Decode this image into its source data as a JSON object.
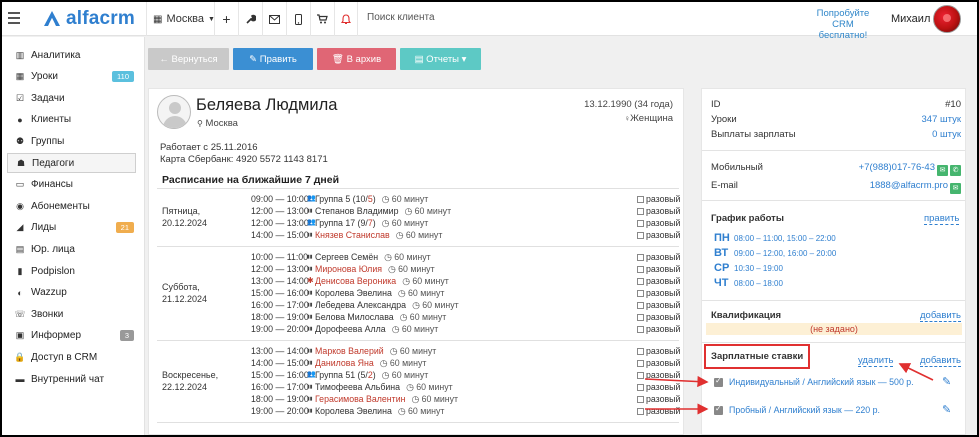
{
  "colors": {
    "accent": "#2f7fcf",
    "back": "#c9c9c9",
    "edit": "#3b8fd3",
    "archive": "#e06675",
    "reports": "#5dc9c5",
    "red_link": "#c0392b",
    "highlight": "#e03030",
    "badge_blue": "#5bc0de",
    "badge_orange": "#f0ad4e",
    "badge_gray": "#999999"
  },
  "topbar": {
    "logo_text": "alfacrm",
    "branch": "Москва",
    "search_placeholder": "Поиск клиента",
    "promo_line1": "Попробуйте",
    "promo_line2": "CRM бесплатно!",
    "user_name": "Михаил",
    "icons": [
      "menu-icon",
      "plus-icon",
      "wrench-icon",
      "mail-icon",
      "phone-icon",
      "cart-icon",
      "bell-icon"
    ]
  },
  "sidebar": {
    "items": [
      {
        "label": "Аналитика",
        "icon": "analytics-icon"
      },
      {
        "label": "Уроки",
        "icon": "calendar-icon",
        "badge": "110"
      },
      {
        "label": "Задачи",
        "icon": "tasks-icon"
      },
      {
        "label": "Клиенты",
        "icon": "user-icon"
      },
      {
        "label": "Группы",
        "icon": "users-icon"
      },
      {
        "label": "Педагоги",
        "icon": "teacher-icon"
      },
      {
        "label": "Финансы",
        "icon": "money-icon"
      },
      {
        "label": "Абонементы",
        "icon": "ticket-icon"
      },
      {
        "label": "Лиды",
        "icon": "leads-icon",
        "badge": "21"
      },
      {
        "label": "Юр. лица",
        "icon": "building-icon"
      },
      {
        "label": "Podpislon",
        "icon": "document-icon"
      },
      {
        "label": "Wazzup",
        "icon": "chat-icon"
      },
      {
        "label": "Звонки",
        "icon": "phone-icon"
      },
      {
        "label": "Информер",
        "icon": "informer-icon",
        "badge": "3"
      },
      {
        "label": "Доступ в CRM",
        "icon": "lock-icon"
      },
      {
        "label": "Внутренний чат",
        "icon": "chat-window-icon"
      }
    ]
  },
  "actions": {
    "back": "← Вернуться",
    "edit": "✎ Править",
    "archive": "🗑 В архив",
    "reports": "▤ Отчеты ▾"
  },
  "profile": {
    "name": "Беляева Людмила",
    "city": "Москва",
    "dob": "13.12.1990 (34 года)",
    "gender": "Женщина",
    "works_since": "Работает с 25.11.2016",
    "bank_card": "Карта Сбербанк: 4920 5572 1143 8171"
  },
  "schedule": {
    "title": "Расписание на ближайшие 7 дней",
    "days": [
      {
        "day": "Пятница,",
        "date": "20.12.2024",
        "rows": [
          {
            "time": "09:00 — 10:00",
            "kind": "group",
            "name": "Группа 5 (10/",
            "name_red": "5",
            "name_tail": ")",
            "dur": "60 минут",
            "rep": "разовый"
          },
          {
            "time": "12:00 — 13:00",
            "kind": "single",
            "name": "Степанов Владимир",
            "dur": "60 минут",
            "rep": "разовый"
          },
          {
            "time": "12:00 — 13:00",
            "kind": "group",
            "name": "Группа 17 (9/",
            "name_red": "7",
            "name_tail": ")",
            "dur": "60 минут",
            "rep": "разовый"
          },
          {
            "time": "14:00 — 15:00",
            "kind": "single",
            "name": "Князев Станислав",
            "red": true,
            "dur": "60 минут",
            "rep": "разовый"
          }
        ]
      },
      {
        "day": "Суббота,",
        "date": "21.12.2024",
        "rows": [
          {
            "time": "10:00 — 11:00",
            "kind": "single",
            "name": "Сергеев Семён",
            "dur": "60 минут",
            "rep": "разовый"
          },
          {
            "time": "12:00 — 13:00",
            "kind": "single",
            "name": "Миронова Юлия",
            "red": true,
            "dur": "60 минут",
            "rep": "разовый"
          },
          {
            "time": "13:00 — 14:00",
            "kind": "trial",
            "name": "Денисова Вероника",
            "red": true,
            "dur": "60 минут",
            "rep": "разовый"
          },
          {
            "time": "15:00 — 16:00",
            "kind": "single",
            "name": "Королева Эвелина",
            "dur": "60 минут",
            "rep": "разовый"
          },
          {
            "time": "16:00 — 17:00",
            "kind": "single",
            "name": "Лебедева Александра",
            "dur": "60 минут",
            "rep": "разовый"
          },
          {
            "time": "18:00 — 19:00",
            "kind": "single",
            "name": "Белова Милослава",
            "dur": "60 минут",
            "rep": "разовый"
          },
          {
            "time": "19:00 — 20:00",
            "kind": "single",
            "name": "Дорофеева Алла",
            "dur": "60 минут",
            "rep": "разовый"
          }
        ]
      },
      {
        "day": "Воскресенье,",
        "date": "22.12.2024",
        "rows": [
          {
            "time": "13:00 — 14:00",
            "kind": "single",
            "name": "Марков Валерий",
            "red": true,
            "dur": "60 минут",
            "rep": "разовый"
          },
          {
            "time": "14:00 — 15:00",
            "kind": "single",
            "name": "Данилова Яна",
            "red": true,
            "dur": "60 минут",
            "rep": "разовый"
          },
          {
            "time": "15:00 — 16:00",
            "kind": "group",
            "name": "Группа 51 (5/",
            "name_red": "2",
            "name_tail": ")",
            "dur": "60 минут",
            "rep": "разовый"
          },
          {
            "time": "16:00 — 17:00",
            "kind": "single",
            "name": "Тимофеева Альбина",
            "dur": "60 минут",
            "rep": "разовый"
          },
          {
            "time": "18:00 — 19:00",
            "kind": "single",
            "name": "Герасимова Валентин",
            "red": true,
            "dur": "60 минут",
            "rep": "разовый"
          },
          {
            "time": "19:00 — 20:00",
            "kind": "single",
            "name": "Королева Эвелина",
            "dur": "60 минут",
            "rep": "разовый"
          }
        ]
      }
    ]
  },
  "details": {
    "id_label": "ID",
    "id_value": "#10",
    "lessons_label": "Уроки",
    "lessons_value": "347 штук",
    "payouts_label": "Выплаты зарплаты",
    "payouts_value": "0 штук",
    "mobile_label": "Мобильный",
    "mobile_value": "+7(988)017-76-43",
    "email_label": "E-mail",
    "email_value": "1888@alfacrm.pro",
    "schedule_title": "График работы",
    "schedule_edit": "править",
    "work_days": [
      {
        "d": "ПН",
        "h": "08:00 – 11:00, 15:00 – 22:00"
      },
      {
        "d": "ВТ",
        "h": "09:00 – 12:00, 16:00 – 20:00"
      },
      {
        "d": "СР",
        "h": "10:30 – 19:00"
      },
      {
        "d": "ЧТ",
        "h": "08:00 – 18:00"
      }
    ],
    "qual_title": "Квалификация",
    "qual_add": "добавить",
    "qual_value": "(не задано)",
    "rates_title": "Зарплатные ставки",
    "rates_delete": "удалить",
    "rates_add": "добавить",
    "rates": [
      {
        "label": "Индивидуальный / Английский язык — 500 р."
      },
      {
        "label": "Пробный / Английский язык — 220 р."
      }
    ]
  }
}
